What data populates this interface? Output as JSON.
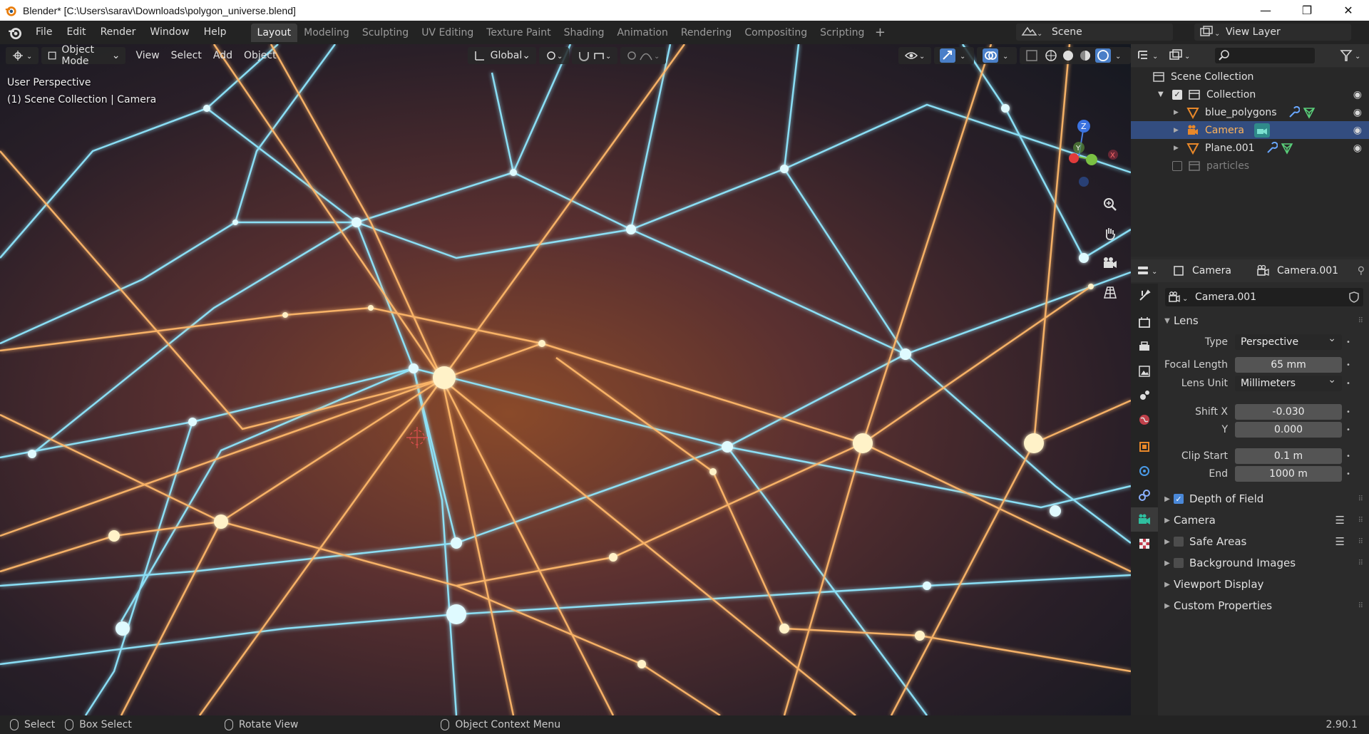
{
  "titlebar": {
    "title": "Blender* [C:\\Users\\sarav\\Downloads\\polygon_universe.blend]"
  },
  "menu": {
    "items": [
      "File",
      "Edit",
      "Render",
      "Window",
      "Help"
    ]
  },
  "workspaces": {
    "tabs": [
      "Layout",
      "Modeling",
      "Sculpting",
      "UV Editing",
      "Texture Paint",
      "Shading",
      "Animation",
      "Rendering",
      "Compositing",
      "Scripting"
    ],
    "active": "Layout"
  },
  "scene": {
    "label": "Scene"
  },
  "view_layer": {
    "label": "View Layer"
  },
  "viewport": {
    "mode": "Object Mode",
    "menus": [
      "View",
      "Select",
      "Add",
      "Object"
    ],
    "transform_orientation": "Global",
    "info_line1": "User Perspective",
    "info_line2": "(1) Scene Collection | Camera",
    "axes": {
      "x": "X",
      "y": "Y",
      "z": "Z"
    }
  },
  "outliner": {
    "root": "Scene Collection",
    "items": [
      {
        "label": "Collection",
        "level": 1
      },
      {
        "label": "blue_polygons",
        "level": 2
      },
      {
        "label": "Camera",
        "level": 2,
        "selected": true
      },
      {
        "label": "Plane.001",
        "level": 2
      },
      {
        "label": "particles",
        "level": 1,
        "disabled": true
      }
    ]
  },
  "properties": {
    "breadcrumb_object": "Camera",
    "breadcrumb_data": "Camera.001",
    "data_name": "Camera.001",
    "lens": {
      "header": "Lens",
      "type_label": "Type",
      "type_value": "Perspective",
      "focal_label": "Focal Length",
      "focal_value": "65 mm",
      "unit_label": "Lens Unit",
      "unit_value": "Millimeters",
      "shiftx_label": "Shift X",
      "shiftx_value": "-0.030",
      "shifty_label": "Y",
      "shifty_value": "0.000",
      "clipstart_label": "Clip Start",
      "clipstart_value": "0.1 m",
      "clipend_label": "End",
      "clipend_value": "1000 m"
    },
    "panels": [
      "Depth of Field",
      "Camera",
      "Safe Areas",
      "Background Images",
      "Viewport Display",
      "Custom Properties"
    ]
  },
  "statusbar": {
    "select": "Select",
    "box_select": "Box Select",
    "rotate": "Rotate View",
    "context": "Object Context Menu",
    "version": "2.90.1"
  }
}
